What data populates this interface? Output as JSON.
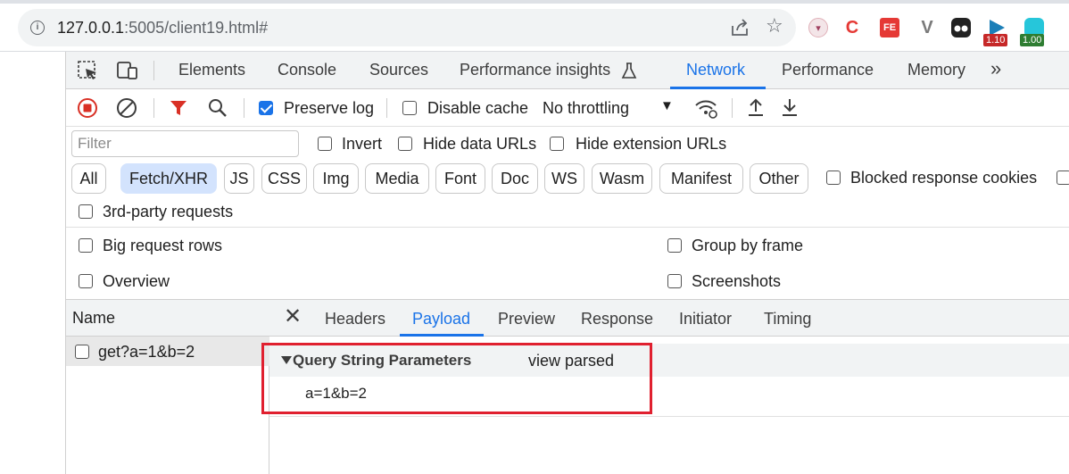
{
  "browser": {
    "url_host": "127.0.0.1",
    "url_rest": ":5005/client19.html#",
    "extensions": [
      {
        "name": "C",
        "icon": "ext-c-icon"
      },
      {
        "name": "FE",
        "icon": "ext-fe-icon"
      },
      {
        "name": "V",
        "icon": "ext-v-icon"
      },
      {
        "name": "",
        "icon": "ext-mask-icon"
      }
    ],
    "badges": [
      "1.10",
      "1.00"
    ]
  },
  "devtools": {
    "tabs": [
      "Elements",
      "Console",
      "Sources",
      "Performance insights",
      "Network",
      "Performance",
      "Memory"
    ],
    "active_tab": "Network",
    "more_tabs": "»",
    "toolbar": {
      "preserve_log": "Preserve log",
      "disable_cache": "Disable cache",
      "throttling": "No throttling"
    },
    "filter": {
      "placeholder": "Filter",
      "invert": "Invert",
      "hide_data_urls": "Hide data URLs",
      "hide_extension_urls": "Hide extension URLs",
      "types": [
        "All",
        "Fetch/XHR",
        "JS",
        "CSS",
        "Img",
        "Media",
        "Font",
        "Doc",
        "WS",
        "Wasm",
        "Manifest",
        "Other"
      ],
      "active_type": "Fetch/XHR",
      "blocked_response_cookies": "Blocked response cookies",
      "third_party": "3rd-party requests"
    },
    "settings": {
      "big_request_rows": "Big request rows",
      "group_by_frame": "Group by frame",
      "overview": "Overview",
      "screenshots": "Screenshots"
    },
    "requests": {
      "column_name": "Name",
      "rows": [
        {
          "name": "get?a=1&b=2"
        }
      ]
    },
    "detail": {
      "close": "✕",
      "tabs": [
        "Headers",
        "Payload",
        "Preview",
        "Response",
        "Initiator",
        "Timing"
      ],
      "active_tab": "Payload",
      "section_title": "Query String Parameters",
      "view_toggle": "view parsed",
      "query_string": "a=1&b=2"
    }
  },
  "colors": {
    "accent": "#1a73e8",
    "record_red": "#d93025",
    "highlight": "#e0202f"
  }
}
